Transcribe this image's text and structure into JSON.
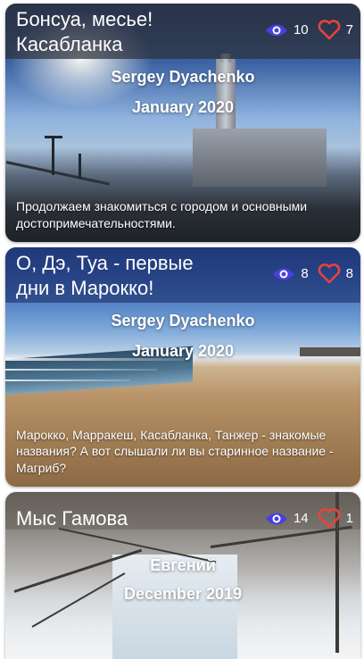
{
  "colors": {
    "eye_icon": "#4a3fe0",
    "heart_icon": "#e8433d"
  },
  "cards": [
    {
      "title": "Бонсуа, месье!\nКасабланка",
      "views": "10",
      "likes": "7",
      "author": "Sergey Dyachenko",
      "date": "January 2020",
      "description": "Продолжаем знакомиться с городом и основными достопримечательностями."
    },
    {
      "title": "О, Дэ, Туа - первые\nдни в Марокко!",
      "views": "8",
      "likes": "8",
      "author": "Sergey Dyachenko",
      "date": "January 2020",
      "description": "Марокко, Марракеш, Касабланка, Танжер - знакомые названия? А вот слышали ли вы старинное название - Магриб?"
    },
    {
      "title": "Мыс Гамова",
      "views": "14",
      "likes": "1",
      "author": "Евгений",
      "date": "December 2019",
      "description": ""
    }
  ]
}
